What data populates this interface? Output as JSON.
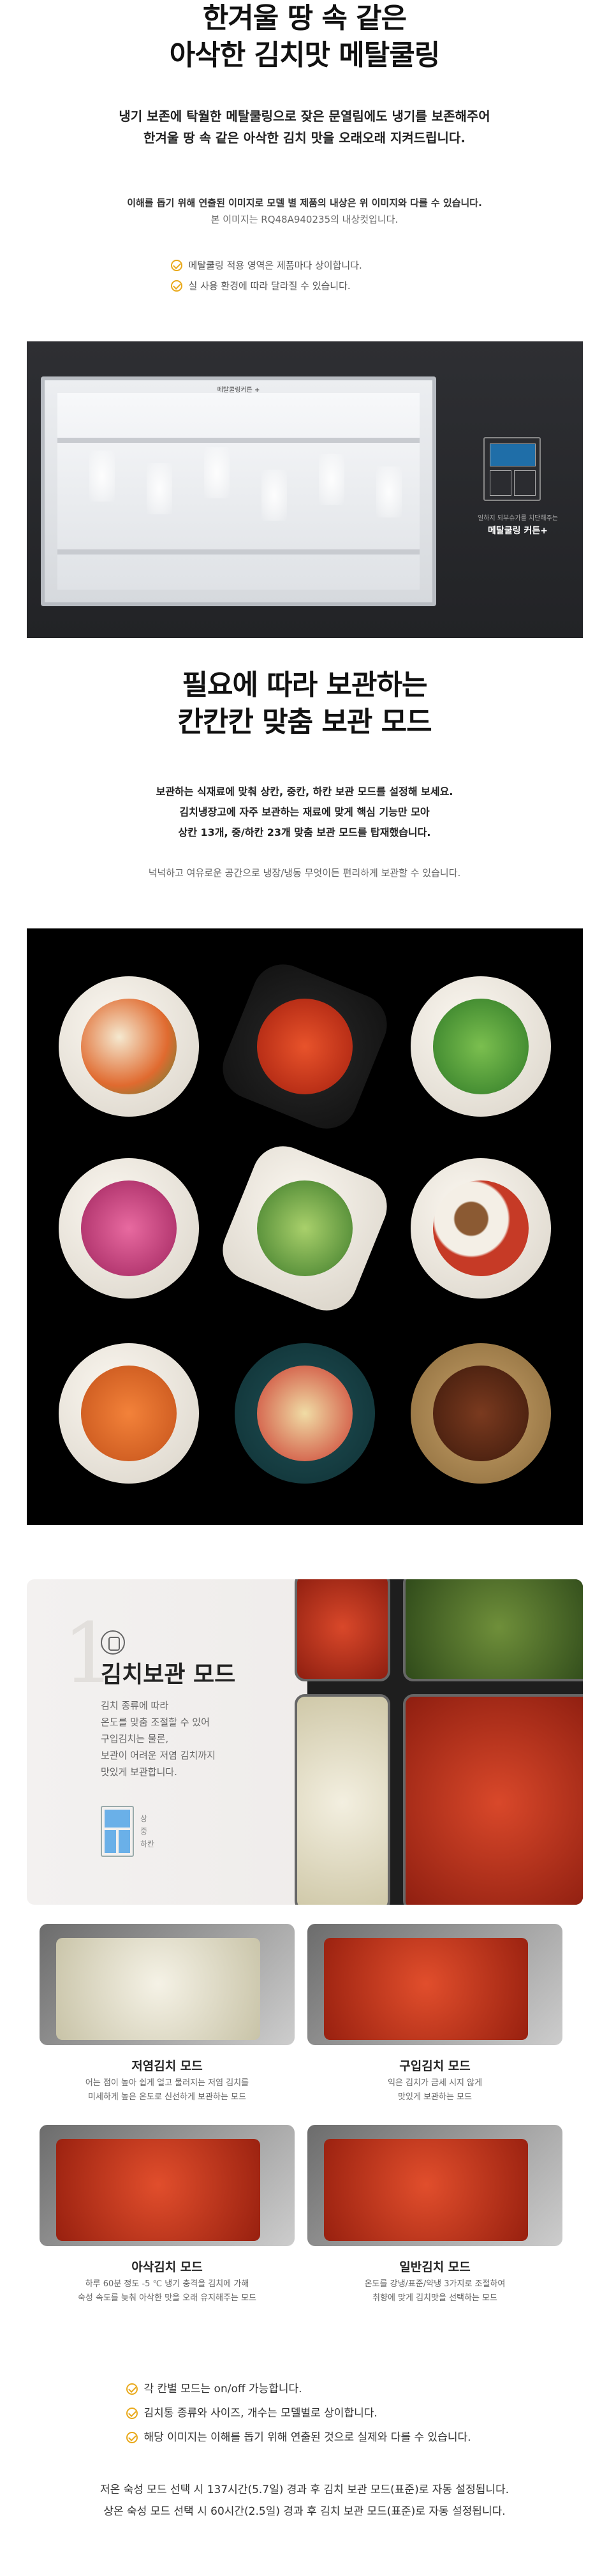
{
  "section1": {
    "title_lines": [
      "한겨울 땅 속 같은",
      "아삭한 김치맛 메탈쿨링"
    ],
    "desc_lines": [
      "냉기 보존에 탁월한 메탈쿨링으로 잦은 문열림에도 냉기를 보존해주어",
      "한겨울 땅 속 같은 아삭한 김치 맛을 오래오래 지켜드립니다."
    ],
    "note_bold": "이해를 돕기 위해 연출된 이미지로 모델 별 제품의 내상은 위 이미지와 다를 수 있습니다.",
    "note": "본 이미지는 RQ48A940235의 내상컷입니다.",
    "checks": [
      "메탈쿨링 적용 영역은 제품마다 상이합니다.",
      "실 사용 환경에 따라 달라질 수 있습니다."
    ],
    "banner": {
      "fridge_label": "메탈쿨링커튼 +",
      "caption_small": "일하지 되부슈가를 치단해주는",
      "caption": "메탈쿨링 커튼+"
    }
  },
  "section2": {
    "title_lines": [
      "필요에 따라 보관하는",
      "칸칸칸 맞춤 보관 모드"
    ],
    "desc_lines": [
      "보관하는 식재료에 맞춰 상칸, 중칸, 하칸 보관 모드를 설정해 보세요.",
      "김치냉장고에 자주 보관하는 재료에 맞게 핵심 기능만 모아",
      "상칸 13개, 중/하칸 23개 맞춤 보관 모드를 탑재했습니다."
    ],
    "note": "넉넉하고 여유로운 공간으로 냉장/냉동 무엇이든 편리하게 보관할 수 있습니다."
  },
  "kimchi_mode": {
    "number": "1",
    "title": "김치보관 모드",
    "desc_lines": [
      "김치 종류에 따라",
      "온도를 맞춤 조절할 수 있어",
      "구입김치는 물론,",
      "보관이 어려운 저염 김치까지",
      "맛있게 보관합니다."
    ],
    "mini_labels": [
      "상",
      "중",
      "하칸"
    ]
  },
  "modes": [
    {
      "name": "저염김치 모드",
      "desc_lines": [
        "어는 점이 높아 쉽게 얼고 물러지는 저염 김치를",
        "미세하게 높은 온도로 신선하게 보관하는 모드"
      ]
    },
    {
      "name": "구입김치 모드",
      "desc_lines": [
        "익은 김치가 금세 시지 않게",
        "맛있게 보관하는 모드"
      ]
    },
    {
      "name": "아삭김치 모드",
      "desc_lines": [
        "하루 60분 정도 -5 ℃ 냉기 충격을 김치에 가해",
        "숙성 속도를 늦춰 아삭한 맛을 오래 유지해주는 모드"
      ]
    },
    {
      "name": "일반김치 모드",
      "desc_lines": [
        "온도를 강냉/표준/약냉 3가지로 조절하여",
        "취향에 맞게 김치맛을 선택하는 모드"
      ]
    }
  ],
  "final_checks": [
    "각 칸별 모드는 on/off 가능합니다.",
    "김치통 종류와 사이즈, 개수는 모델별로 상이합니다.",
    "해당 이미지는 이해를 돕기 위해 연출된 것으로 실제와 다를 수 있습니다."
  ],
  "final_notes": [
    "저온 숙성 모드 선택 시 137시간(5.7일) 경과 후 김치 보관 모드(표준)로 자동 설정됩니다.",
    "상온 숙성 모드 선택 시 60시간(2.5일) 경과 후 김치 보관 모드(표준)로 자동 설정됩니다."
  ],
  "colors": {
    "accent": "#e9a91b",
    "dark_panel": "#000000",
    "banner": "#2e2f33"
  }
}
